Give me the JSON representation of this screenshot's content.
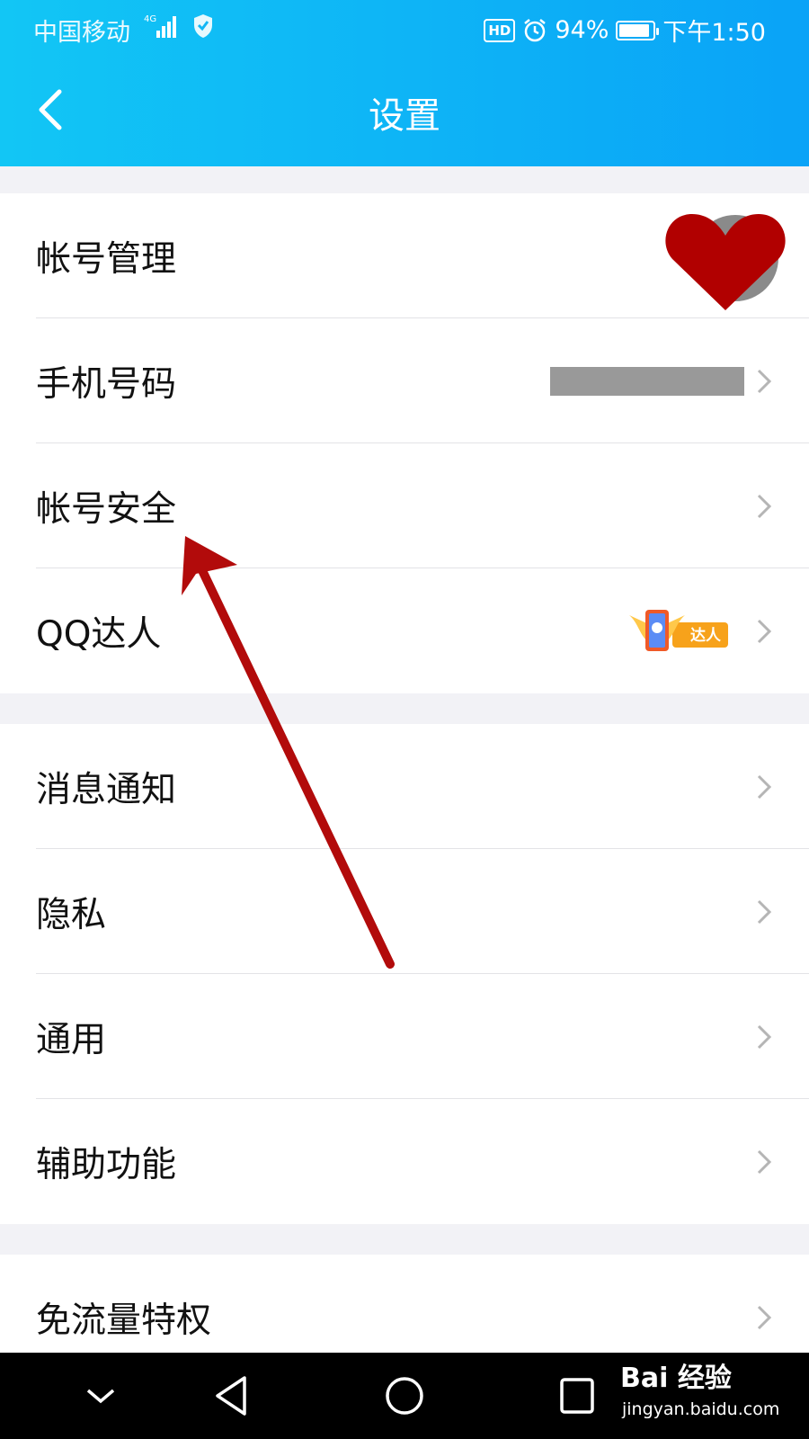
{
  "status_bar": {
    "carrier": "中国移动",
    "network": "4G",
    "hd": "HD",
    "battery": "94%",
    "time": "下午1:50"
  },
  "header": {
    "title": "设置"
  },
  "groups": [
    {
      "items": [
        {
          "label": "帐号管理"
        },
        {
          "label": "手机号码"
        },
        {
          "label": "帐号安全"
        },
        {
          "label": "QQ达人",
          "badge": "达人"
        }
      ]
    },
    {
      "items": [
        {
          "label": "消息通知"
        },
        {
          "label": "隐私"
        },
        {
          "label": "通用"
        },
        {
          "label": "辅助功能"
        }
      ]
    },
    {
      "items": [
        {
          "label": "免流量特权"
        }
      ]
    }
  ],
  "watermark": {
    "brand": "Bai 经验",
    "url": "jingyan.baidu.com"
  },
  "colors": {
    "header_start": "#12c6f5",
    "header_end": "#0aa3f7",
    "annotation_arrow": "#b20b0b",
    "background": "#f2f2f6"
  }
}
